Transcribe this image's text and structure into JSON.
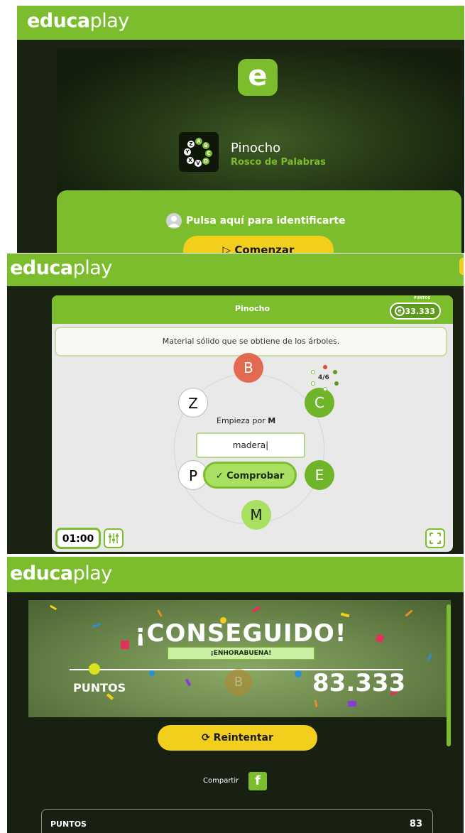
{
  "brand": {
    "name_bold": "educa",
    "name_light": "play",
    "accent": "#7bbd2d",
    "yellow": "#f2cf1d"
  },
  "intro": {
    "badge_letter": "e",
    "game_name": "Pinocho",
    "game_type": "Rosco de Palabras",
    "identify_label": "Pulsa aquí para identificarte",
    "start_label": "Comenzar",
    "icon_letters": [
      "A",
      "B",
      "C",
      "D",
      "V",
      "X",
      "Y",
      "Z"
    ]
  },
  "game": {
    "title": "Pinocho",
    "points_label": "PUNTOS",
    "points_value": "33.333",
    "question": "Material sólido que se obtiene de los árboles.",
    "letters": {
      "B": "B",
      "C": "C",
      "E": "E",
      "M": "M",
      "P": "P",
      "Z": "Z"
    },
    "progress": "4/6",
    "hint_prefix": "Empieza por",
    "hint_letter": "M",
    "answer_value": "madera",
    "check_label": "Comprobar",
    "timer": "01:00"
  },
  "result": {
    "headline": "¡CONSEGUIDO!",
    "congrats": "¡ENHORABUENA!",
    "points_label": "PUNTOS",
    "score": "83.333",
    "faded_letter": "B",
    "retry_label": "Reintentar",
    "share_label": "Compartir",
    "share_icon_letter": "f",
    "table": [
      {
        "key": "PUNTOS",
        "value": "83"
      }
    ]
  }
}
